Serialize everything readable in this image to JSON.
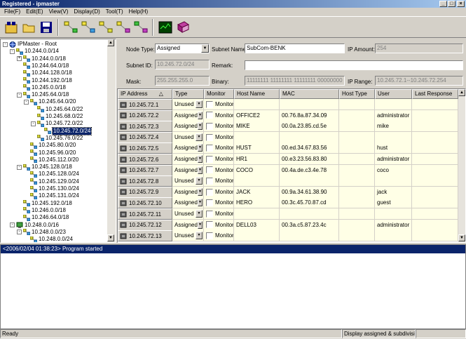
{
  "window": {
    "title": "Registered - ipmaster"
  },
  "menu": [
    "File(F)",
    "Edit(E)",
    "View(V)",
    "Display(D)",
    "Tool(T)",
    "Help(H)"
  ],
  "tree": [
    {
      "label": "IPMaster - Root",
      "level": 0,
      "exp": "-",
      "icon": "root"
    },
    {
      "label": "10.244.0.0/14",
      "level": 1,
      "exp": "-",
      "icon": "net"
    },
    {
      "label": "10.244.0.0/18",
      "level": 2,
      "exp": "+",
      "icon": "net"
    },
    {
      "label": "10.244.64.0/18",
      "level": 2,
      "exp": "",
      "icon": "net"
    },
    {
      "label": "10.244.128.0/18",
      "level": 2,
      "exp": "",
      "icon": "net"
    },
    {
      "label": "10.244.192.0/18",
      "level": 2,
      "exp": "",
      "icon": "net"
    },
    {
      "label": "10.245.0.0/18",
      "level": 2,
      "exp": "",
      "icon": "net"
    },
    {
      "label": "10.245.64.0/18",
      "level": 2,
      "exp": "-",
      "icon": "net"
    },
    {
      "label": "10.245.64.0/20",
      "level": 3,
      "exp": "-",
      "icon": "net"
    },
    {
      "label": "10.245.64.0/22",
      "level": 4,
      "exp": "",
      "icon": "net"
    },
    {
      "label": "10.245.68.0/22",
      "level": 4,
      "exp": "",
      "icon": "net"
    },
    {
      "label": "10.245.72.0/22",
      "level": 4,
      "exp": "-",
      "icon": "net"
    },
    {
      "label": "10.245.72.0/24",
      "level": 5,
      "exp": "",
      "icon": "net",
      "selected": true
    },
    {
      "label": "10.245.76.0/22",
      "level": 4,
      "exp": "",
      "icon": "net"
    },
    {
      "label": "10.245.80.0/20",
      "level": 3,
      "exp": "",
      "icon": "net"
    },
    {
      "label": "10.245.96.0/20",
      "level": 3,
      "exp": "",
      "icon": "net"
    },
    {
      "label": "10.245.112.0/20",
      "level": 3,
      "exp": "",
      "icon": "net"
    },
    {
      "label": "10.245.128.0/18",
      "level": 2,
      "exp": "-",
      "icon": "net"
    },
    {
      "label": "10.245.128.0/24",
      "level": 3,
      "exp": "",
      "icon": "net"
    },
    {
      "label": "10.245.129.0/24",
      "level": 3,
      "exp": "",
      "icon": "net"
    },
    {
      "label": "10.245.130.0/24",
      "level": 3,
      "exp": "",
      "icon": "net"
    },
    {
      "label": "10.245.131.0/24",
      "level": 3,
      "exp": "",
      "icon": "net"
    },
    {
      "label": "10.245.192.0/18",
      "level": 2,
      "exp": "",
      "icon": "net"
    },
    {
      "label": "10.246.0.0/18",
      "level": 2,
      "exp": "",
      "icon": "net"
    },
    {
      "label": "10.246.64.0/18",
      "level": 2,
      "exp": "",
      "icon": "net"
    },
    {
      "label": "10.248.0.0/16",
      "level": 1,
      "exp": "-",
      "icon": "host"
    },
    {
      "label": "10.248.0.0/23",
      "level": 2,
      "exp": "-",
      "icon": "net"
    },
    {
      "label": "10.248.0.0/24",
      "level": 3,
      "exp": "",
      "icon": "net"
    }
  ],
  "form": {
    "node_type_label": "Node Type:",
    "node_type_value": "Assigned",
    "subnet_name_label": "Subnet Name:",
    "subnet_name_value": "SubCom-BENK",
    "ip_amount_label": "IP Amount:",
    "ip_amount_value": "254",
    "subnet_id_label": "Subnet ID:",
    "subnet_id_value": "10.245.72.0/24",
    "remark_label": "Remark:",
    "remark_value": "",
    "mask_label": "Mask:",
    "mask_value": "255.255.255.0",
    "binary_label": "Binary:",
    "binary_value": "11111111 11111111 11111111 00000000",
    "ip_range_label": "IP Range:",
    "ip_range_value": "10.245.72.1--10.245.72.254"
  },
  "grid": {
    "columns": [
      "IP Address",
      "Type",
      "Monitor",
      "Host Name",
      "MAC",
      "Host Type",
      "User",
      "Last Response"
    ],
    "sort_indicator": "△",
    "monitor_label": "Monitor",
    "rows": [
      {
        "ip": "10.245.72.1",
        "type": "Unused",
        "host": "",
        "mac": "",
        "hosttype": "",
        "user": ""
      },
      {
        "ip": "10.245.72.2",
        "type": "Assigned",
        "host": "OFFICE2",
        "mac": "00.76.8a.87.34.09",
        "hosttype": "",
        "user": "administrator"
      },
      {
        "ip": "10.245.72.3",
        "type": "Assigned",
        "host": "MIKE",
        "mac": "00.0a.23.85.cd.5e",
        "hosttype": "",
        "user": "mike"
      },
      {
        "ip": "10.245.72.4",
        "type": "Unused",
        "host": "",
        "mac": "",
        "hosttype": "",
        "user": ""
      },
      {
        "ip": "10.245.72.5",
        "type": "Assigned",
        "host": "HUST",
        "mac": "00.ed.34.67.83.56",
        "hosttype": "",
        "user": "hust"
      },
      {
        "ip": "10.245.72.6",
        "type": "Assigned",
        "host": "HR1",
        "mac": "00.e3.23.56.83.80",
        "hosttype": "",
        "user": "administrator"
      },
      {
        "ip": "10.245.72.7",
        "type": "Assigned",
        "host": "COCO",
        "mac": "00.4a.de.c3.4e.78",
        "hosttype": "",
        "user": "coco"
      },
      {
        "ip": "10.245.72.8",
        "type": "Unused",
        "host": "",
        "mac": "",
        "hosttype": "",
        "user": ""
      },
      {
        "ip": "10.245.72.9",
        "type": "Assigned",
        "host": "JACK",
        "mac": "00.9a.34.61.38.90",
        "hosttype": "",
        "user": "jack"
      },
      {
        "ip": "10.245.72.10",
        "type": "Assigned",
        "host": "HERO",
        "mac": "00.3c.45.70.87.cd",
        "hosttype": "",
        "user": "guest"
      },
      {
        "ip": "10.245.72.11",
        "type": "Unused",
        "host": "",
        "mac": "",
        "hosttype": "",
        "user": ""
      },
      {
        "ip": "10.245.72.12",
        "type": "Assigned",
        "host": "DELL03",
        "mac": "00.3a.c5.87.23.4c",
        "hosttype": "",
        "user": "administrator"
      },
      {
        "ip": "10.245.72.13",
        "type": "Unused",
        "host": "",
        "mac": "",
        "hosttype": "",
        "user": ""
      }
    ]
  },
  "log": {
    "entry": "<2006/02/04 01:38:23> Program started"
  },
  "status": {
    "left": "Ready",
    "right": "Display assigned & subdivisible s"
  }
}
